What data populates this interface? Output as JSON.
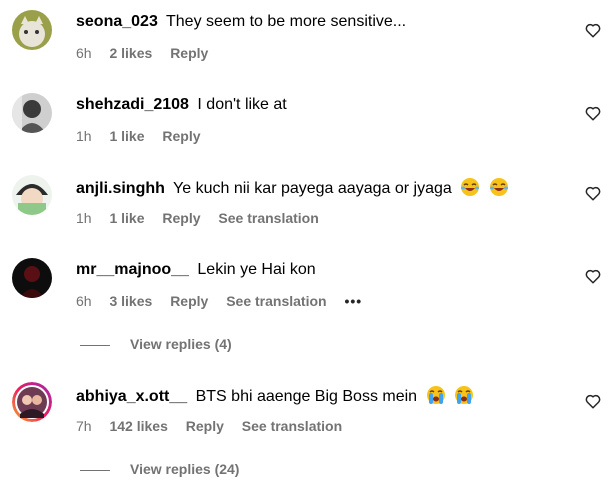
{
  "comments": [
    {
      "username": "seona_023",
      "text": "They seem to be more sensitive...",
      "time": "6h",
      "likes": "2 likes",
      "reply": "Reply",
      "translate": "",
      "emoji_count": 0
    },
    {
      "username": "shehzadi_2108",
      "text": "I don't like at",
      "time": "1h",
      "likes": "1 like",
      "reply": "Reply",
      "translate": "",
      "emoji_count": 0
    },
    {
      "username": "anjli.singhh",
      "text": "Ye kuch nii kar payega aayaga or jyaga",
      "time": "1h",
      "likes": "1 like",
      "reply": "Reply",
      "translate": "See translation",
      "emoji_count": 2,
      "emoji": "laughing-emoji"
    },
    {
      "username": "mr__majnoo__",
      "text": "Lekin ye Hai kon",
      "time": "6h",
      "likes": "3 likes",
      "reply": "Reply",
      "translate": "See translation",
      "more": "•••",
      "emoji_count": 0
    },
    {
      "username": "abhiya_x.ott__",
      "text": "BTS bhi aaenge Big Boss mein",
      "time": "7h",
      "likes": "142 likes",
      "reply": "Reply",
      "translate": "See translation",
      "emoji_count": 2,
      "emoji": "crying-emoji"
    }
  ],
  "view_replies": [
    "View replies (4)",
    "View replies (24)"
  ],
  "icons": {
    "heart": "heart-outline-icon"
  },
  "colors": {
    "meta_text": "#737373",
    "text": "#000000"
  }
}
